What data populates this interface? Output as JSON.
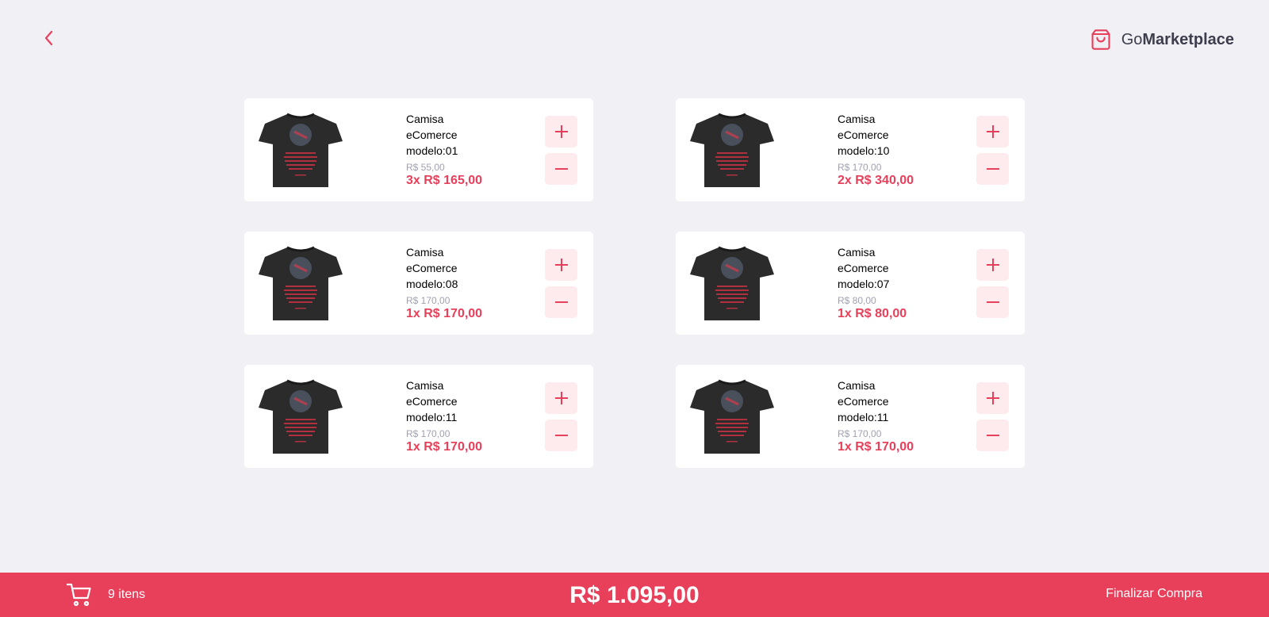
{
  "header": {
    "brand_prefix": "Go",
    "brand_main": "Marketplace",
    "back_icon": "chevron-left-icon",
    "brand_icon": "shopping-bag-icon"
  },
  "colors": {
    "accent": "#e83f5b",
    "background": "#f0f0f5",
    "text_dark": "#3d3d4d",
    "text_muted": "#a0a0b3"
  },
  "cart_items": [
    {
      "title": "Camisa eComerce modelo:01",
      "unit_price": "R$ 55,00",
      "subtotal": "3x R$ 165,00"
    },
    {
      "title": "Camisa eComerce modelo:10",
      "unit_price": "R$ 170,00",
      "subtotal": "2x R$ 340,00"
    },
    {
      "title": "Camisa eComerce modelo:08",
      "unit_price": "R$ 170,00",
      "subtotal": "1x R$ 170,00"
    },
    {
      "title": "Camisa eComerce modelo:07",
      "unit_price": "R$ 80,00",
      "subtotal": "1x R$ 80,00"
    },
    {
      "title": "Camisa eComerce modelo:11",
      "unit_price": "R$ 170,00",
      "subtotal": "1x R$ 170,00"
    },
    {
      "title": "Camisa eComerce modelo:11",
      "unit_price": "R$ 170,00",
      "subtotal": "1x R$ 170,00"
    }
  ],
  "footer": {
    "item_count": "9 itens",
    "total": "R$ 1.095,00",
    "checkout_label": "Finalizar Compra",
    "cart_icon": "shopping-cart-icon"
  }
}
